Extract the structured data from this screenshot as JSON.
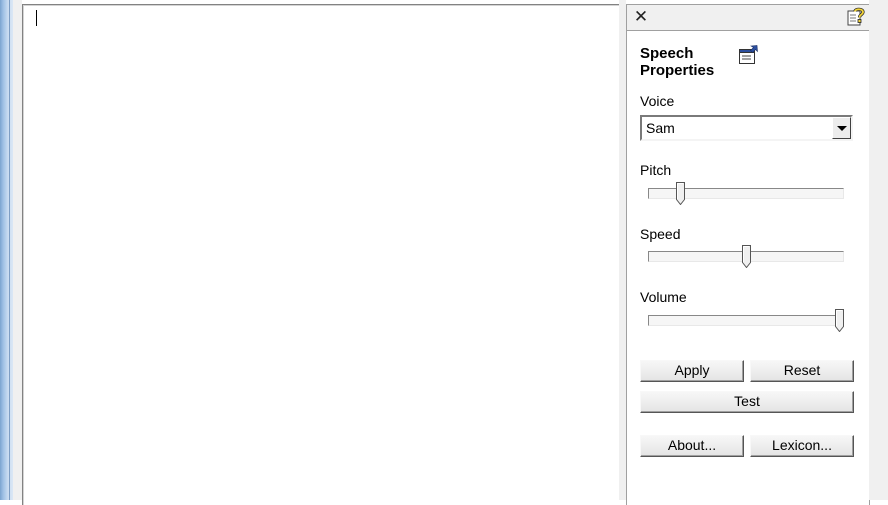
{
  "speech_properties": {
    "title": "Speech Properties",
    "voice": {
      "label": "Voice",
      "selected": "Sam"
    },
    "pitch": {
      "label": "Pitch",
      "level": 0.15
    },
    "speed": {
      "label": "Speed",
      "level": 0.5
    },
    "volume": {
      "label": "Volume",
      "level": 1.0
    },
    "buttons": {
      "apply": "Apply",
      "reset": "Reset",
      "test": "Test",
      "about": "About...",
      "lexicon": "Lexicon..."
    }
  },
  "header": {
    "close_glyph": "✕"
  },
  "icons": {
    "close": "close-icon",
    "help": "help-icon",
    "properties": "properties-icon"
  }
}
